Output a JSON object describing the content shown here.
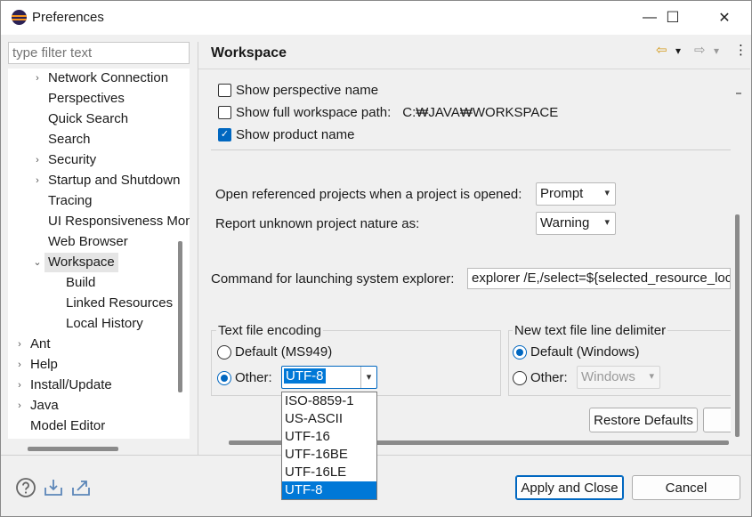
{
  "window": {
    "title": "Preferences",
    "min_glyph": "—",
    "max_glyph": "☐",
    "close_glyph": "✕"
  },
  "filter": {
    "placeholder": "type filter text"
  },
  "tree": {
    "items": [
      {
        "label": "Network Connection",
        "expander": "›"
      },
      {
        "label": "Perspectives",
        "expander": ""
      },
      {
        "label": "Quick Search",
        "expander": ""
      },
      {
        "label": "Search",
        "expander": ""
      },
      {
        "label": "Security",
        "expander": "›"
      },
      {
        "label": "Startup and Shutdown",
        "expander": "›"
      },
      {
        "label": "Tracing",
        "expander": ""
      },
      {
        "label": "UI Responsiveness Monitoring",
        "expander": ""
      },
      {
        "label": "Web Browser",
        "expander": ""
      },
      {
        "label": "Workspace",
        "expander": "⌄"
      },
      {
        "label": "Build",
        "expander": ""
      },
      {
        "label": "Linked Resources",
        "expander": ""
      },
      {
        "label": "Local History",
        "expander": ""
      },
      {
        "label": "Ant",
        "expander": "›"
      },
      {
        "label": "Help",
        "expander": "›"
      },
      {
        "label": "Install/Update",
        "expander": "›"
      },
      {
        "label": "Java",
        "expander": "›"
      },
      {
        "label": "Model Editor",
        "expander": ""
      }
    ]
  },
  "page": {
    "title": "Workspace",
    "back_glyph": "⇦",
    "forward_glyph": "⇨",
    "dropdown_glyph": "▾",
    "menu_glyph": "⋮"
  },
  "checkboxes": {
    "show_perspective_name": {
      "label": "Show perspective name",
      "checked": false
    },
    "show_full_path": {
      "label": "Show full workspace path:",
      "checked": false,
      "value": "C:₩JAVA₩WORKSPACE"
    },
    "show_product_name": {
      "label": "Show product name",
      "checked": true,
      "mark": "✓"
    }
  },
  "open_projects": {
    "label": "Open referenced projects when a project is opened:",
    "value": "Prompt"
  },
  "unknown_nature": {
    "label": "Report unknown project nature as:",
    "value": "Warning"
  },
  "explorer": {
    "label": "Command for launching system explorer:",
    "value": "explorer /E,/select=${selected_resource_loc}"
  },
  "encoding": {
    "title": "Text file encoding",
    "default_label": "Default (MS949)",
    "other_label": "Other:",
    "selected": "other",
    "other_value": "UTF-8",
    "options": [
      "ISO-8859-1",
      "US-ASCII",
      "UTF-16",
      "UTF-16BE",
      "UTF-16LE",
      "UTF-8"
    ],
    "highlighted_option": "UTF-8"
  },
  "line_delimiter": {
    "title": "New text file line delimiter",
    "default_label": "Default (Windows)",
    "other_label": "Other:",
    "selected": "default",
    "other_value": "Windows"
  },
  "buttons": {
    "restore_defaults": "Restore Defaults",
    "apply_and_close": "Apply and Close",
    "cancel": "Cancel"
  },
  "icons": {
    "help": "help-icon",
    "import": "import-icon",
    "export": "export-icon"
  },
  "colors": {
    "accent": "#0067c0",
    "selection": "#0078d7"
  }
}
